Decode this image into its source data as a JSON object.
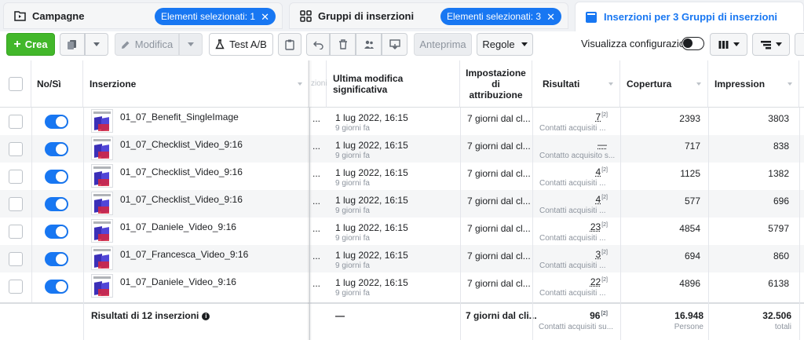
{
  "tabs": [
    {
      "title": "Campagne",
      "pill": "Elementi selezionati: 1",
      "icon": "folder-icon"
    },
    {
      "title": "Gruppi di inserzioni",
      "pill": "Elementi selezionati: 3",
      "icon": "grid-icon"
    },
    {
      "title": "Inserzioni per 3 Gruppi di inserzioni",
      "icon": "ad-icon"
    }
  ],
  "toolbar": {
    "create": "Crea",
    "edit": "Modifica",
    "ab_test": "Test A/B",
    "preview": "Anteprima",
    "rules": "Regole",
    "show_config": "Visualizza configurazione"
  },
  "table": {
    "headers": {
      "on_off": "No/Sì",
      "ad": "Inserzione",
      "hidden": "zioni",
      "last_edit": "Ultima modifica significativa",
      "attribution": "Impostazione di attribuzione",
      "results": "Risultati",
      "reach": "Copertura",
      "impressions": "Impression"
    },
    "rows": [
      {
        "name": "01_07_Benefit_SingleImage",
        "date": "1 lug 2022, 16:15",
        "ago": "9 giorni fa",
        "attr": "7 giorni dal cl...",
        "results": "7",
        "results_ref": "[2]",
        "results_sub": "Contatti acquisiti ...",
        "reach": "2393",
        "impressions": "3803"
      },
      {
        "name": "01_07_Checklist_Video_9:16",
        "date": "1 lug 2022, 16:15",
        "ago": "9 giorni fa",
        "attr": "7 giorni dal cl...",
        "results": "—",
        "results_ref": "",
        "results_sub": "Contatto acquisito s...",
        "reach": "717",
        "impressions": "838"
      },
      {
        "name": "01_07_Checklist_Video_9:16",
        "date": "1 lug 2022, 16:15",
        "ago": "9 giorni fa",
        "attr": "7 giorni dal cl...",
        "results": "4",
        "results_ref": "[2]",
        "results_sub": "Contatti acquisiti ...",
        "reach": "1125",
        "impressions": "1382"
      },
      {
        "name": "01_07_Checklist_Video_9:16",
        "date": "1 lug 2022, 16:15",
        "ago": "9 giorni fa",
        "attr": "7 giorni dal cl...",
        "results": "4",
        "results_ref": "[2]",
        "results_sub": "Contatti acquisiti ...",
        "reach": "577",
        "impressions": "696"
      },
      {
        "name": "01_07_Daniele_Video_9:16",
        "date": "1 lug 2022, 16:15",
        "ago": "9 giorni fa",
        "attr": "7 giorni dal cl...",
        "results": "23",
        "results_ref": "[2]",
        "results_sub": "Contatti acquisiti ...",
        "reach": "4854",
        "impressions": "5797"
      },
      {
        "name": "01_07_Francesca_Video_9:16",
        "date": "1 lug 2022, 16:15",
        "ago": "9 giorni fa",
        "attr": "7 giorni dal cl...",
        "results": "3",
        "results_ref": "[2]",
        "results_sub": "Contatti acquisiti ...",
        "reach": "694",
        "impressions": "860"
      },
      {
        "name": "01_07_Daniele_Video_9:16",
        "date": "1 lug 2022, 16:15",
        "ago": "9 giorni fa",
        "attr": "7 giorni dal cl...",
        "results": "22",
        "results_ref": "[2]",
        "results_sub": "Contatti acquisiti ...",
        "reach": "4896",
        "impressions": "6138"
      }
    ],
    "totals": {
      "label": "Risultati di 12 inserzioni",
      "last_edit": "—",
      "attribution": "7 giorni dal cli...",
      "results": "96",
      "results_ref": "[2]",
      "results_sub": "Contatti acquisiti su...",
      "reach": "16.948",
      "reach_sub": "Persone",
      "impressions": "32.506",
      "impressions_sub": "totali"
    }
  },
  "colors": {
    "accent": "#1877f2",
    "create": "#42b72a",
    "row_alt": "#f5f6f7"
  }
}
